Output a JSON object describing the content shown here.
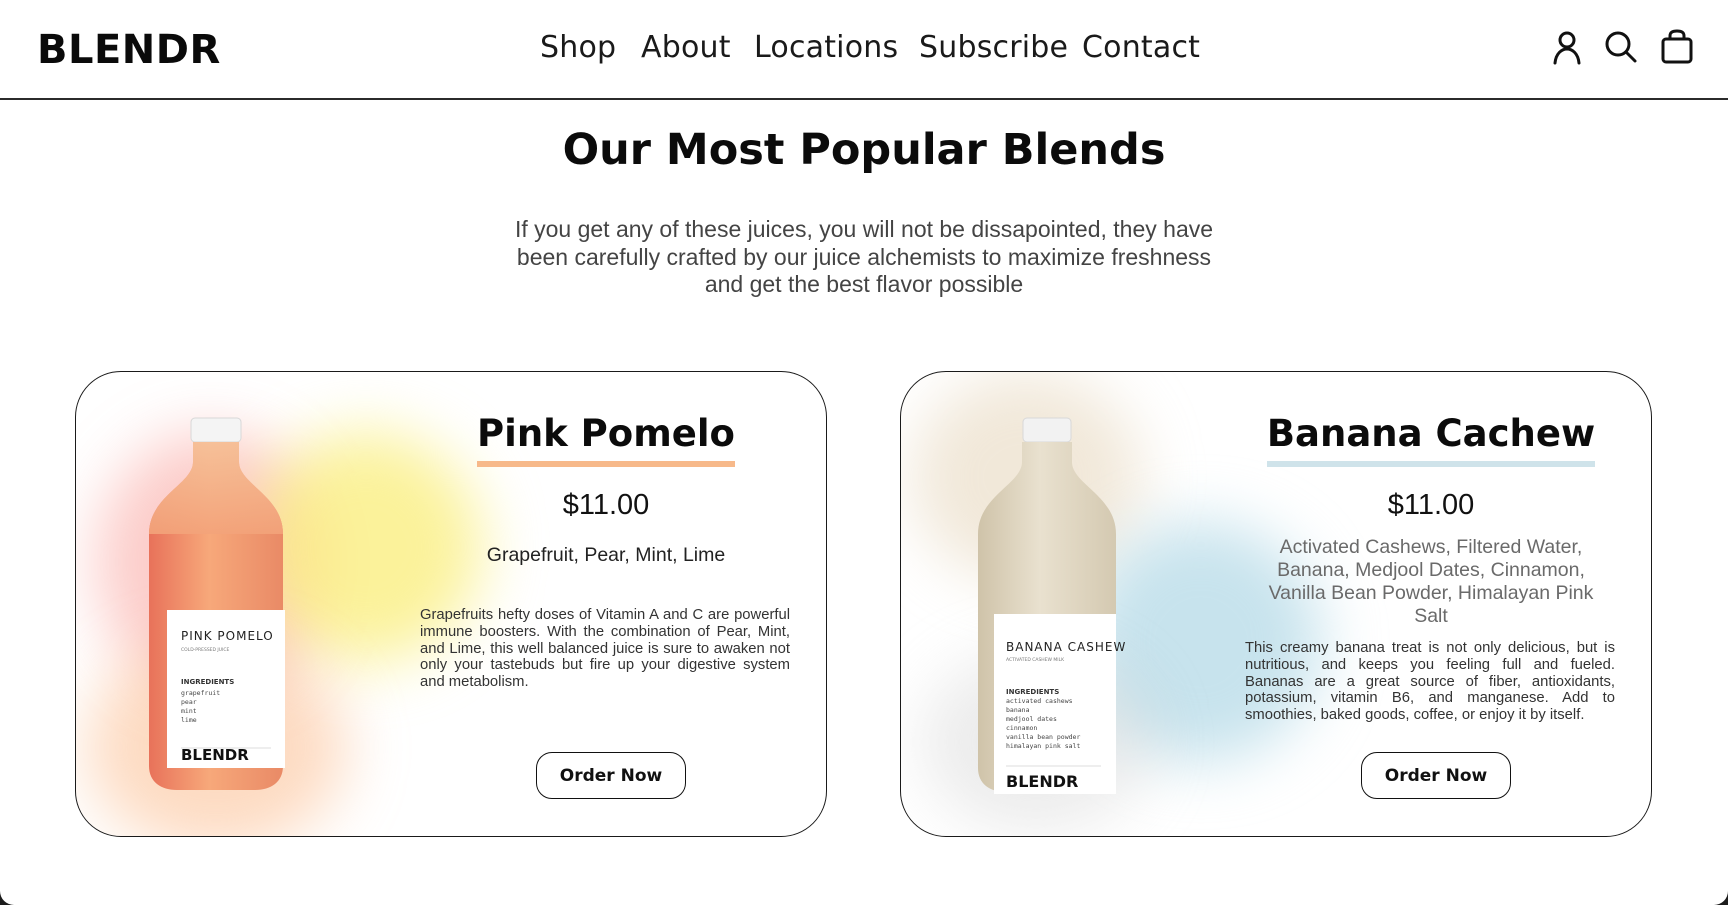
{
  "brand": {
    "logo": "BLENDR"
  },
  "nav": {
    "items": [
      {
        "label": "Shop"
      },
      {
        "label": "About"
      },
      {
        "label": "Locations"
      },
      {
        "label": "Subscribe"
      },
      {
        "label": "Contact"
      }
    ]
  },
  "header_icons": [
    "account-icon",
    "search-icon",
    "shopping-bag-icon"
  ],
  "hero": {
    "title": "Our Most Popular Blends",
    "subtitle": "If you get any of these juices, you will not be dissapointed, they have been carefully crafted by our juice alchemists to maximize freshness and get the best flavor possible"
  },
  "products": [
    {
      "name": "Pink Pomelo",
      "price": "$11.00",
      "ingredients": "Grapefruit, Pear, Mint, Lime",
      "description": "Grapefruits hefty doses of Vitamin A and C are powerful immune boosters. With the combination of Pear, Mint, and Lime, this well balanced juice is sure to awaken not only your tastebuds but fire up your digestive system and metabolism.",
      "cta": "Order Now",
      "accent": "#f7b98a",
      "label": {
        "name": "PINK POMELO",
        "subtitle": "COLD-PRESSED JUICE",
        "ingredients_title": "INGREDIENTS",
        "ingredients": [
          "grapefruit",
          "pear",
          "mint",
          "lime"
        ],
        "brand": "BLENDR"
      }
    },
    {
      "name": "Banana Cachew",
      "price": "$11.00",
      "ingredients": "Activated Cashews, Filtered Water, Banana, Medjool Dates, Cinnamon, Vanilla Bean Powder, Himalayan Pink Salt",
      "description": "This creamy banana treat is not only delicious, but is nutritious, and keeps you feeling full and fueled. Bananas are a great source of fiber, antioxidants, potassium, vitamin B6, and manganese. Add to smoothies, baked goods, coffee, or enjoy it by itself.",
      "cta": "Order Now",
      "accent": "#cfe3ea",
      "label": {
        "name": "BANANA CASHEW",
        "subtitle": "ACTIVATED CASHEW MILK",
        "ingredients_title": "INGREDIENTS",
        "ingredients": [
          "activated cashews",
          "banana",
          "medjool dates",
          "cinnamon",
          "vanilla bean powder",
          "himalayan pink salt"
        ],
        "brand": "BLENDR"
      }
    }
  ]
}
